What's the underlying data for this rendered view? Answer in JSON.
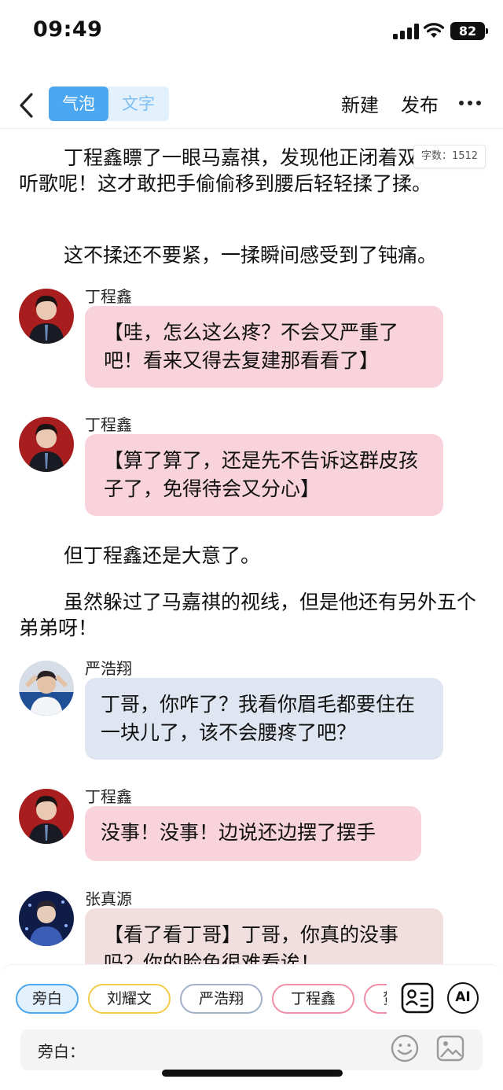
{
  "status_bar": {
    "time": "09:49",
    "battery": "82"
  },
  "header": {
    "tabs": [
      {
        "label": "气泡",
        "active": true
      },
      {
        "label": "文字",
        "active": false
      }
    ],
    "new_label": "新建",
    "publish_label": "发布"
  },
  "word_count": "字数：1512",
  "content": {
    "para1": "丁程鑫瞟了一眼马嘉祺，发现他正闭着双眼安心听歌呢！这才敢把手偷偷移到腰后轻轻揉了揉。",
    "para2": "这不揉还不要紧，一揉瞬间感受到了钝痛。",
    "msg1": {
      "speaker": "丁程鑫",
      "text": "【哇，怎么这么疼？不会又严重了吧！看来又得去复建那看看了】"
    },
    "msg2": {
      "speaker": "丁程鑫",
      "text": "【算了算了，还是先不告诉这群皮孩子了，免得待会又分心】"
    },
    "para3": "但丁程鑫还是大意了。",
    "para4": "虽然躲过了马嘉祺的视线，但是他还有另外五个弟弟呀！",
    "msg3": {
      "speaker": "严浩翔",
      "text": "丁哥，你咋了？我看你眉毛都要住在一块儿了，该不会腰疼了吧？"
    },
    "msg4": {
      "speaker": "丁程鑫",
      "text": "没事！没事！边说还边摆了摆手"
    },
    "msg5": {
      "speaker": "张真源",
      "text": "【看了看丁哥】丁哥，你真的没事吗？你的脸色很难看诶！"
    }
  },
  "bottom": {
    "chips": [
      "旁白",
      "刘耀文",
      "严浩翔",
      "丁程鑫",
      "贺峻霖"
    ],
    "input_label": "旁白："
  },
  "colors": {
    "accent": "#4aa7f0",
    "bubble_pink": "#f8d3dc",
    "bubble_blue": "#e0e6f1",
    "bubble_rose": "#f1dede"
  }
}
